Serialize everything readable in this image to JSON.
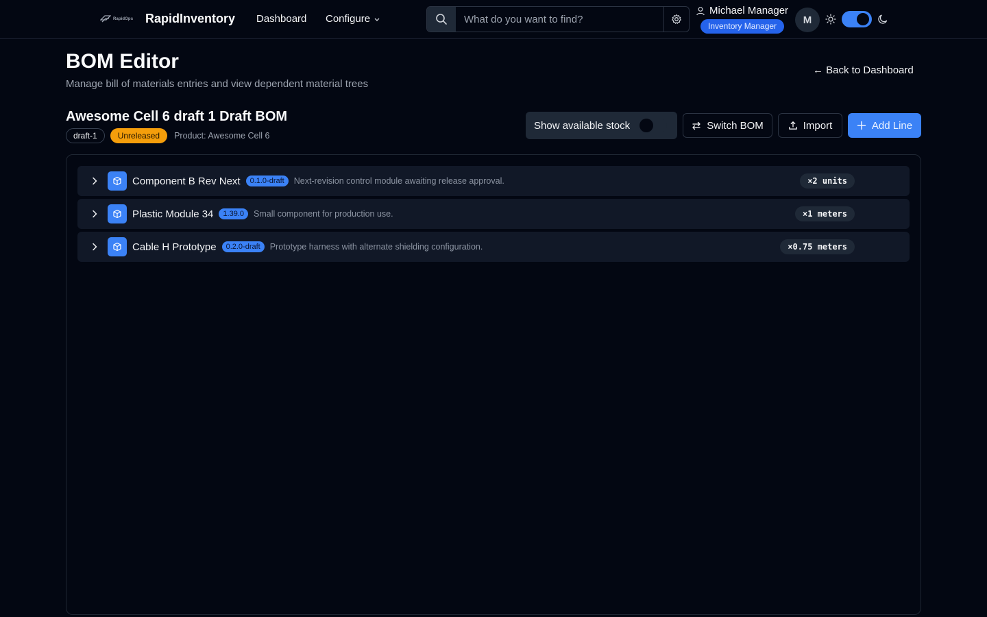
{
  "app": {
    "logo_text": "RapidOps",
    "brand_name": "RapidInventory"
  },
  "nav": {
    "dashboard_label": "Dashboard",
    "configure_label": "Configure"
  },
  "search": {
    "placeholder": "What do you want to find?",
    "value": ""
  },
  "user": {
    "name": "Michael Manager",
    "role": "Inventory Manager",
    "avatar_initial": "M"
  },
  "theme": {
    "dark_mode_on": true
  },
  "header": {
    "title": "BOM Editor",
    "subtitle": "Manage bill of materials entries and view dependent material trees",
    "back_link": "← Back to Dashboard"
  },
  "bom": {
    "title": "Awesome Cell 6 draft 1 Draft BOM",
    "revision_tag": "draft-1",
    "status": "Unreleased",
    "product_label": "Product: Awesome Cell 6"
  },
  "toolbar": {
    "stock_toggle_label": "Show available stock",
    "stock_toggle_on": false,
    "switch_label": "Switch BOM",
    "import_label": "Import",
    "add_line_label": "Add Line"
  },
  "lines": [
    {
      "name": "Component B Rev Next",
      "version": "0.1.0-draft",
      "description": "Next-revision control module awaiting release approval.",
      "quantity": "×2 units"
    },
    {
      "name": "Plastic Module 34",
      "version": "1.39.0",
      "description": "Small component for production use.",
      "quantity": "×1 meters"
    },
    {
      "name": "Cable H Prototype",
      "version": "0.2.0-draft",
      "description": "Prototype harness with alternate shielding configuration.",
      "quantity": "×0.75 meters"
    }
  ],
  "colors": {
    "background": "#030712",
    "accent": "#3b82f6",
    "warning": "#f59e0b",
    "row_bg": "#111827"
  }
}
